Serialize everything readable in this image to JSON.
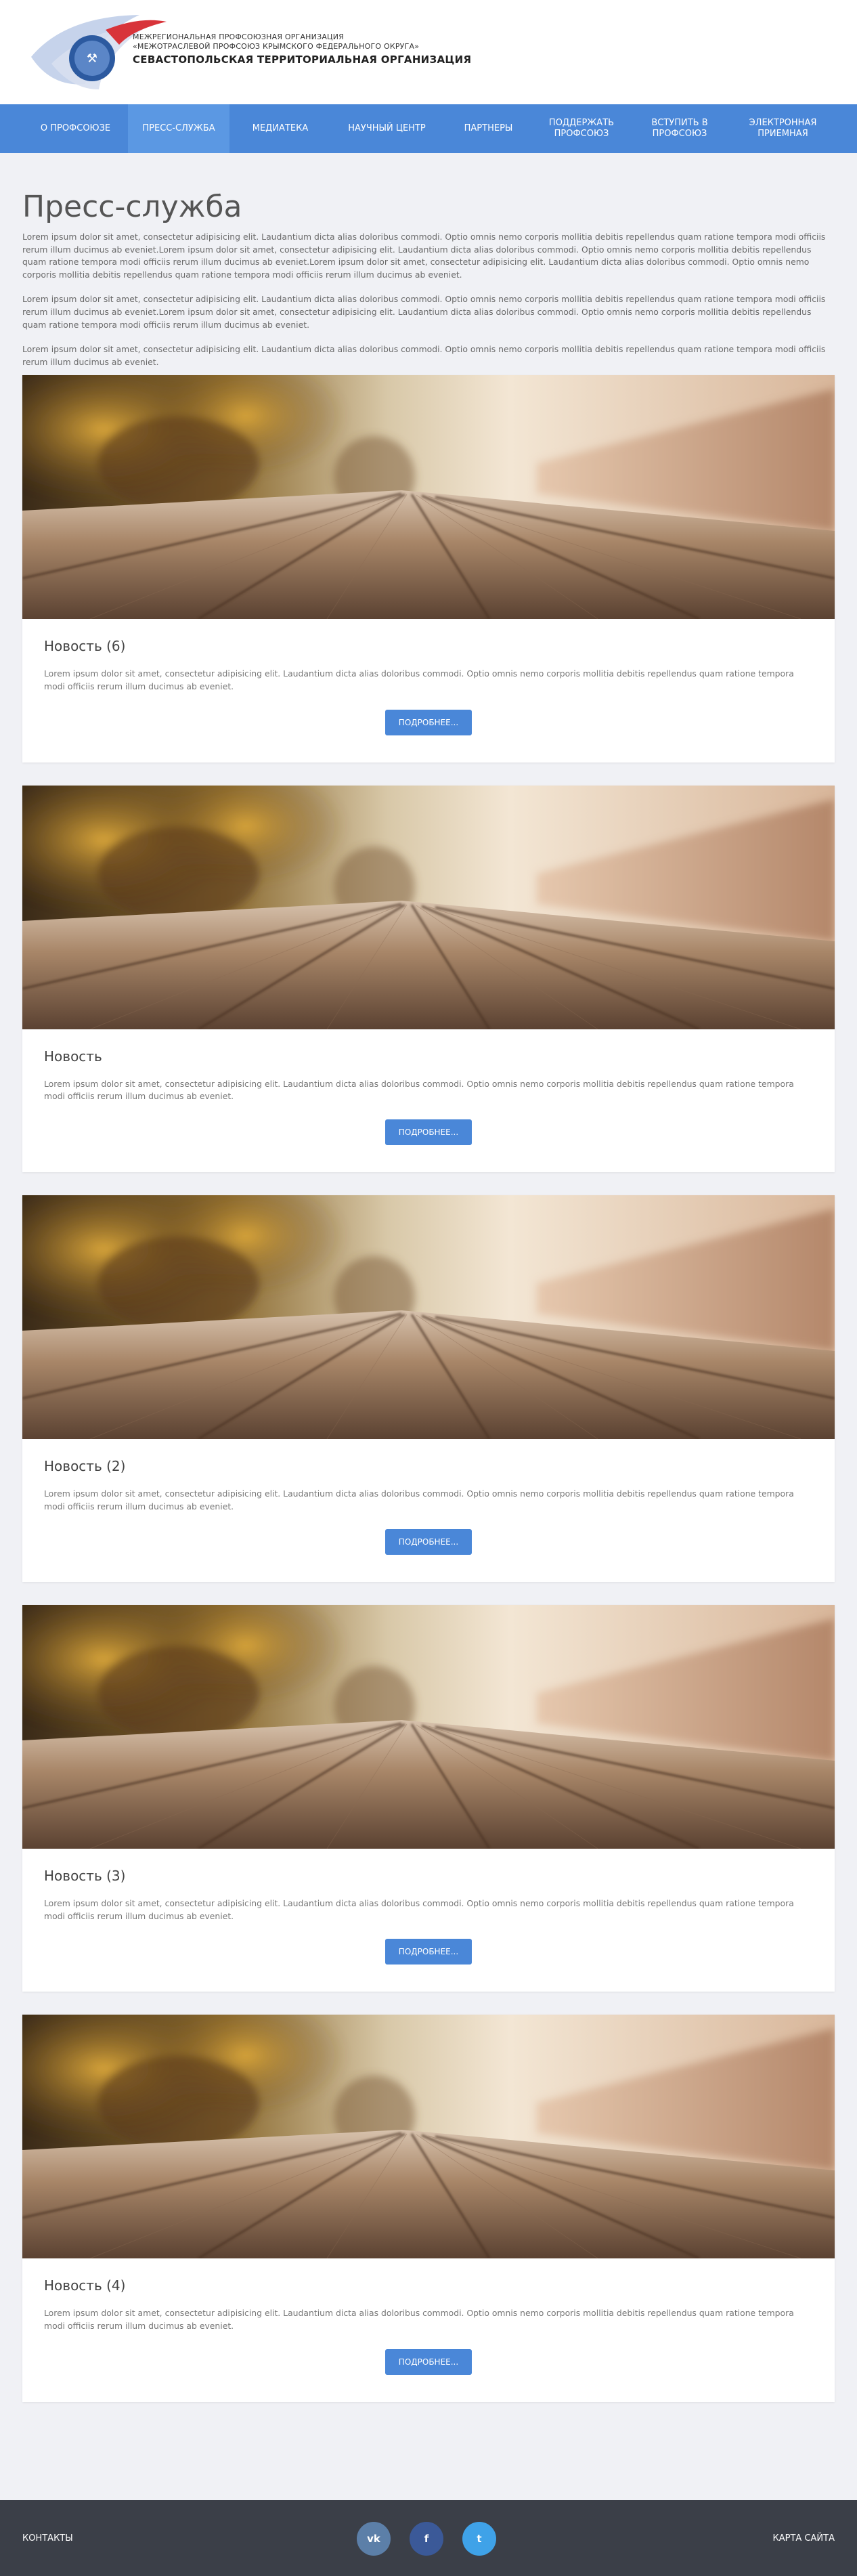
{
  "header": {
    "org_line1": "МЕЖРЕГИОНАЛЬНАЯ ПРОФСОЮЗНАЯ ОРГАНИЗАЦИЯ",
    "org_line2": "«МЕЖОТРАСЛЕВОЙ ПРОФСОЮЗ КРЫМСКОГО ФЕДЕРАЛЬНОГО ОКРУГА»",
    "org_name": "СЕВАСТОПОЛЬСКАЯ ТЕРРИТОРИАЛЬНАЯ ОРГАНИЗАЦИЯ"
  },
  "nav": {
    "items": [
      {
        "label": "О ПРОФСОЮЗЕ"
      },
      {
        "label": "ПРЕСС-СЛУЖБА"
      },
      {
        "label": "МЕДИАТЕКА"
      },
      {
        "label": "НАУЧНЫЙ ЦЕНТР"
      },
      {
        "label": "ПАРТНЕРЫ"
      },
      {
        "label": "ПОДДЕРЖАТЬ ПРОФСОЮЗ"
      },
      {
        "label": "ВСТУПИТЬ В ПРОФСОЮЗ"
      },
      {
        "label": "ЭЛЕКТРОННАЯ ПРИЕМНАЯ"
      }
    ]
  },
  "page": {
    "title": "Пресс-служба",
    "intro": [
      "Lorem ipsum dolor sit amet, consectetur adipisicing elit. Laudantium dicta alias doloribus commodi. Optio omnis nemo corporis mollitia debitis repellendus quam ratione tempora modi officiis rerum illum ducimus ab eveniet.Lorem ipsum dolor sit amet, consectetur adipisicing elit. Laudantium dicta alias doloribus commodi. Optio omnis nemo corporis mollitia debitis repellendus quam ratione tempora modi officiis rerum illum ducimus ab eveniet.Lorem ipsum dolor sit amet, consectetur adipisicing elit. Laudantium dicta alias doloribus commodi. Optio omnis nemo corporis mollitia debitis repellendus quam ratione tempora modi officiis rerum illum ducimus ab eveniet.",
      "Lorem ipsum dolor sit amet, consectetur adipisicing elit. Laudantium dicta alias doloribus commodi. Optio omnis nemo corporis mollitia debitis repellendus quam ratione tempora modi officiis rerum illum ducimus ab eveniet.Lorem ipsum dolor sit amet, consectetur adipisicing elit. Laudantium dicta alias doloribus commodi. Optio omnis nemo corporis mollitia debitis repellendus quam ratione tempora modi officiis rerum illum ducimus ab eveniet.",
      "Lorem ipsum dolor sit amet, consectetur adipisicing elit. Laudantium dicta alias doloribus commodi. Optio omnis nemo corporis mollitia debitis repellendus quam ratione tempora modi officiis rerum illum ducimus ab eveniet."
    ]
  },
  "news": [
    {
      "title": "Новость (6)",
      "text": "Lorem ipsum dolor sit amet, consectetur adipisicing elit. Laudantium dicta alias doloribus commodi. Optio omnis nemo corporis mollitia debitis repellendus quam ratione tempora modi officiis rerum illum ducimus ab eveniet.",
      "button": "ПОДРОБНЕЕ..."
    },
    {
      "title": "Новость",
      "text": "Lorem ipsum dolor sit amet, consectetur adipisicing elit. Laudantium dicta alias doloribus commodi. Optio omnis nemo corporis mollitia debitis repellendus quam ratione tempora modi officiis rerum illum ducimus ab eveniet.",
      "button": "ПОДРОБНЕЕ..."
    },
    {
      "title": "Новость (2)",
      "text": "Lorem ipsum dolor sit amet, consectetur adipisicing elit. Laudantium dicta alias doloribus commodi. Optio omnis nemo corporis mollitia debitis repellendus quam ratione tempora modi officiis rerum illum ducimus ab eveniet.",
      "button": "ПОДРОБНЕЕ..."
    },
    {
      "title": "Новость (3)",
      "text": "Lorem ipsum dolor sit amet, consectetur adipisicing elit. Laudantium dicta alias doloribus commodi. Optio omnis nemo corporis mollitia debitis repellendus quam ratione tempora modi officiis rerum illum ducimus ab eveniet.",
      "button": "ПОДРОБНЕЕ..."
    },
    {
      "title": "Новость (4)",
      "text": "Lorem ipsum dolor sit amet, consectetur adipisicing elit. Laudantium dicta alias doloribus commodi. Optio omnis nemo corporis mollitia debitis repellendus quam ratione tempora modi officiis rerum illum ducimus ab eveniet.",
      "button": "ПОДРОБНЕЕ..."
    }
  ],
  "footer": {
    "contacts": "КОНТАКТЫ",
    "sitemap": "КАРТА САЙТА",
    "socials": [
      {
        "icon": "vk-icon",
        "glyph": "vk",
        "color": "#5c7fa8"
      },
      {
        "icon": "facebook-icon",
        "glyph": "f",
        "color": "#3b5998"
      },
      {
        "icon": "twitter-icon",
        "glyph": "t",
        "color": "#3fa2e8"
      }
    ]
  },
  "colors": {
    "accent": "#4a87d8",
    "nav_active": "#5b98e3",
    "background": "#f0f1f5",
    "footer": "#3b3f48"
  }
}
